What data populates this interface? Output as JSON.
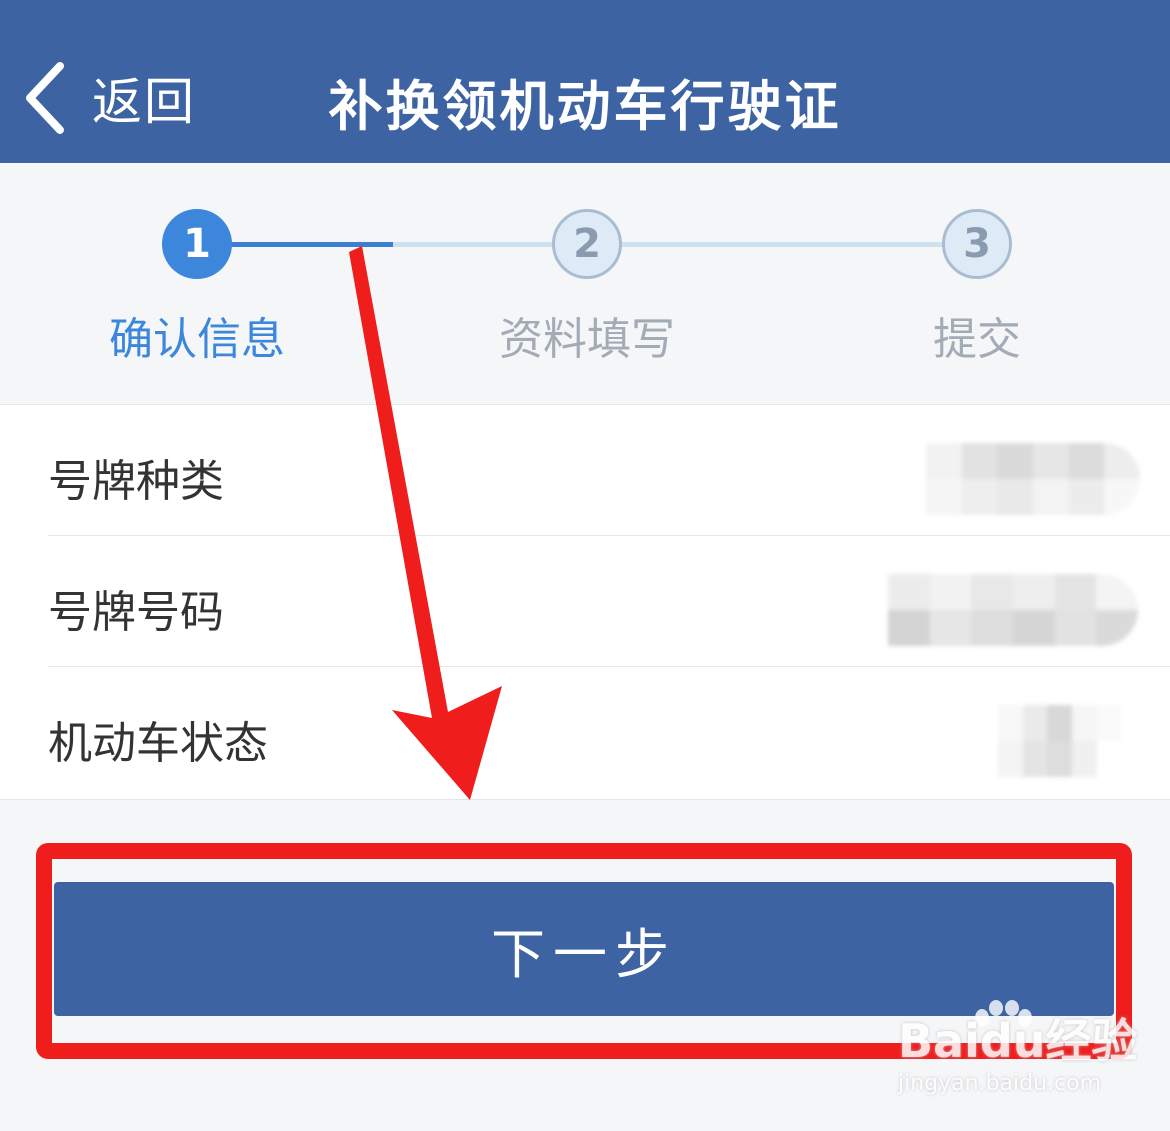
{
  "header": {
    "back_label": "返回",
    "title": "补换领机动车行驶证",
    "background": "#3d63a3"
  },
  "steps": {
    "current": 1,
    "progress": 0.25,
    "items": [
      {
        "number": "1",
        "label": "确认信息",
        "state": "active"
      },
      {
        "number": "2",
        "label": "资料填写",
        "state": "inactive"
      },
      {
        "number": "3",
        "label": "提交",
        "state": "inactive"
      }
    ],
    "active_color": "#3c87dc"
  },
  "info": {
    "rows": [
      {
        "label": "号牌种类",
        "value_obscured": true
      },
      {
        "label": "号牌号码",
        "value_obscured": true
      },
      {
        "label": "机动车状态",
        "value_obscured": true
      }
    ]
  },
  "actions": {
    "next_label": "下一步",
    "highlight_color": "#f01d1d"
  },
  "annotation": {
    "arrow_color": "#f01d1d"
  },
  "watermark": {
    "brand": "Baidu经验",
    "url": "jingyan.baidu.com"
  }
}
